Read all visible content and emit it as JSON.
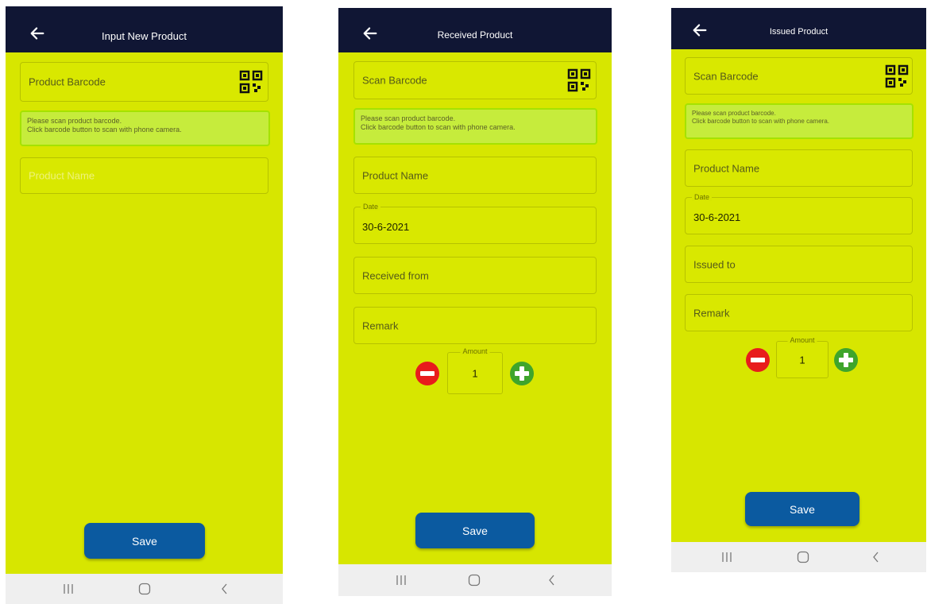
{
  "screens": [
    {
      "title": "Input New Product",
      "barcode_placeholder": "Product Barcode",
      "hint_line1": "Please scan product barcode.",
      "hint_line2": "Click barcode button to scan with phone camera.",
      "product_name_placeholder": "Product Name",
      "save_label": "Save"
    },
    {
      "title": "Received Product",
      "barcode_placeholder": "Scan Barcode",
      "hint_line1": "Please scan product barcode.",
      "hint_line2": "Click barcode button to scan with phone camera.",
      "product_name_placeholder": "Product Name",
      "date_label": "Date",
      "date_value": "30-6-2021",
      "party_placeholder": "Received from",
      "remark_placeholder": "Remark",
      "amount_label": "Amount",
      "amount_value": "1",
      "save_label": "Save"
    },
    {
      "title": "Issued Product",
      "barcode_placeholder": "Scan Barcode",
      "hint_line1": "Please scan product barcode.",
      "hint_line2": "Click barcode button to scan with phone camera.",
      "product_name_placeholder": "Product Name",
      "date_label": "Date",
      "date_value": "30-6-2021",
      "party_placeholder": "Issued to",
      "remark_placeholder": "Remark",
      "amount_label": "Amount",
      "amount_value": "1",
      "save_label": "Save"
    }
  ],
  "icons": {
    "back": "arrow-left-icon",
    "scan": "qr-code-icon",
    "minus": "minus-circle-icon",
    "plus": "plus-circle-icon",
    "recents": "recents-icon",
    "home": "home-icon",
    "nav_back": "chevron-left-icon"
  },
  "colors": {
    "screen_background": "#d7e600",
    "top_bar": "#101634",
    "save_button": "#0b5aa0",
    "hint_border": "#a5e200",
    "minus_button": "#e81c1c",
    "plus_button": "#3fa52b",
    "nav_bar": "#efefef"
  }
}
